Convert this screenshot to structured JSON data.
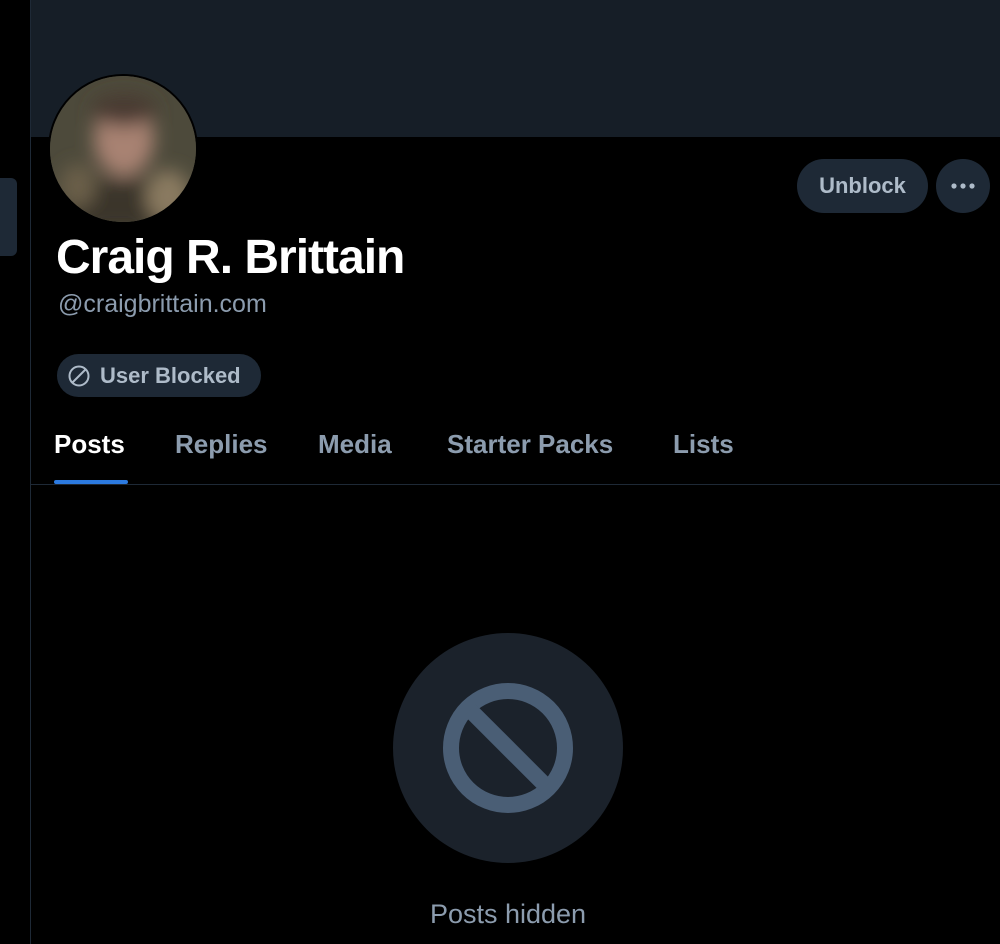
{
  "profile": {
    "display_name": "Craig R. Brittain",
    "handle": "@craigbrittain.com",
    "blocked_label": "User Blocked"
  },
  "actions": {
    "unblock_label": "Unblock",
    "more_icon": "ellipsis-icon"
  },
  "tabs": [
    {
      "label": "Posts",
      "active": true
    },
    {
      "label": "Replies",
      "active": false
    },
    {
      "label": "Media",
      "active": false
    },
    {
      "label": "Starter Packs",
      "active": false
    },
    {
      "label": "Lists",
      "active": false
    }
  ],
  "feed": {
    "empty_icon": "blocked-icon",
    "empty_message": "Posts hidden"
  },
  "colors": {
    "background": "#000000",
    "banner": "#161e27",
    "button_bg": "#1e2936",
    "accent": "#2c7ae0",
    "muted_text": "#8c9cae",
    "icon": "#4a5e75"
  }
}
